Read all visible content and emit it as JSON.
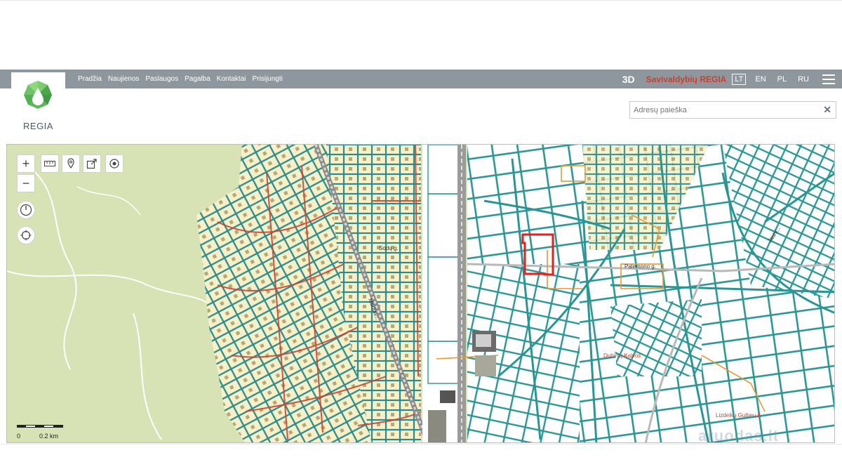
{
  "nav": {
    "links": [
      "Pradžia",
      "Naujienos",
      "Paslaugos",
      "Pagalba",
      "Kontaktai",
      "Prisijungti"
    ]
  },
  "header": {
    "three_d_label": "3D",
    "brand_title": "Savivaldybių REGIA",
    "languages": [
      "LT",
      "EN",
      "PL",
      "RU"
    ],
    "active_language": "LT"
  },
  "logo": {
    "text": "REGIA"
  },
  "search": {
    "placeholder": "Adresų paieška",
    "value": ""
  },
  "map": {
    "controls": {
      "zoom_in": "+",
      "zoom_out": "−"
    },
    "labels": {
      "road_1": "Palemono g.",
      "road_2": "Jauni...",
      "road_3": "Moritav...",
      "area_1": "Dubinių Kalvos",
      "area_2": "Lizdeikų Gulbeu k.",
      "area_3": "Sodų g."
    },
    "scale": {
      "zero": "0",
      "distance": "0.2 km"
    },
    "watermark": "aruodas.lt"
  },
  "colors": {
    "navbar": "#8e979e",
    "brand_red": "#d23c2a",
    "parcel_teal": "#2a9595",
    "road_red": "#d04030",
    "forest_green": "#d7e3b5",
    "highlight": "#ee1d1d"
  }
}
